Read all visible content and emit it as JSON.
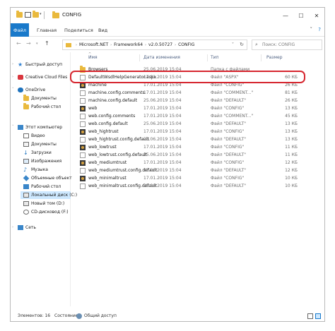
{
  "window": {
    "title": "CONFIG",
    "controls": {
      "minimize": "—",
      "maximize": "☐",
      "close": "✕"
    }
  },
  "ribbon": {
    "tabs": [
      "Файл",
      "Главная",
      "Поделиться",
      "Вид"
    ],
    "expand_icon": "˅",
    "help_icon": "?"
  },
  "address": {
    "crumbs": [
      "Microsoft.NET",
      "Framework64",
      "v2.0.50727",
      "CONFIG"
    ],
    "search_placeholder": "Поиск: CONFIG"
  },
  "sidebar": {
    "items": [
      {
        "label": "Быстрый доступ",
        "icon": "star-icon",
        "color": "#2f80d1"
      },
      {
        "label": "Creative Cloud Files",
        "icon": "creative-cloud-icon",
        "color": "#d9363e"
      },
      {
        "label": "OneDrive",
        "icon": "cloud-icon",
        "color": "#1e73be"
      },
      {
        "label": "Документы",
        "icon": "folder-icon",
        "color": "#e9b93d"
      },
      {
        "label": "Рабочий стол",
        "icon": "folder-icon",
        "color": "#e9b93d"
      },
      {
        "label": "Этот компьютер",
        "icon": "computer-icon",
        "color": "#3a86c9"
      },
      {
        "label": "Видео",
        "icon": "video-icon",
        "color": "#6b6b6b"
      },
      {
        "label": "Документы",
        "icon": "documents-icon",
        "color": "#6b6b6b"
      },
      {
        "label": "Загрузки",
        "icon": "download-icon",
        "color": "#1e73be"
      },
      {
        "label": "Изображения",
        "icon": "pictures-icon",
        "color": "#6b6b6b"
      },
      {
        "label": "Музыка",
        "icon": "music-icon",
        "color": "#1e73be"
      },
      {
        "label": "Объемные объект",
        "icon": "3d-objects-icon",
        "color": "#3a86c9"
      },
      {
        "label": "Рабочий стол",
        "icon": "desktop-icon",
        "color": "#3a86c9"
      },
      {
        "label": "Локальный диск (C:)",
        "icon": "drive-icon",
        "color": "#6b6b6b"
      },
      {
        "label": "Новый том (D:)",
        "icon": "drive-icon",
        "color": "#6b6b6b"
      },
      {
        "label": "CD-дисковод (F:)",
        "icon": "cd-drive-icon",
        "color": "#6b6b6b"
      },
      {
        "label": "Сеть",
        "icon": "network-icon",
        "color": "#3a86c9"
      }
    ]
  },
  "columns": {
    "name": "Имя",
    "date": "Дата изменения",
    "type": "Тип",
    "size": "Размер"
  },
  "files": [
    {
      "name": "Browsers",
      "date": "25.06.2019 15:04",
      "type": "Папка с файлами",
      "size": "",
      "icon": "folder-icon"
    },
    {
      "name": "DefaultWsdlHelpGenerator.aspx",
      "date": "17.01.2019 15:04",
      "type": "Файл \"ASPX\"",
      "size": "60 КБ",
      "icon": "file-icon"
    },
    {
      "name": "machine",
      "date": "17.01.2019 15:04",
      "type": "Файл \"CONFIG\"",
      "size": "26 КБ",
      "icon": "config-file-icon"
    },
    {
      "name": "machine.config.comments",
      "date": "17.01.2019 15:04",
      "type": "Файл \"COMMENT...\"",
      "size": "81 КБ",
      "icon": "file-icon"
    },
    {
      "name": "machine.config.default",
      "date": "25.06.2019 15:04",
      "type": "Файл \"DEFAULT\"",
      "size": "26 КБ",
      "icon": "file-icon"
    },
    {
      "name": "web",
      "date": "17.01.2019 15:04",
      "type": "Файл \"CONFIG\"",
      "size": "13 КБ",
      "icon": "config-file-icon"
    },
    {
      "name": "web.config.comments",
      "date": "17.01.2019 15:04",
      "type": "Файл \"COMMENT...\"",
      "size": "45 КБ",
      "icon": "file-icon"
    },
    {
      "name": "web.config.default",
      "date": "25.06.2019 15:04",
      "type": "Файл \"DEFAULT\"",
      "size": "13 КБ",
      "icon": "file-icon"
    },
    {
      "name": "web_hightrust",
      "date": "17.01.2019 15:04",
      "type": "Файл \"CONFIG\"",
      "size": "13 КБ",
      "icon": "config-file-icon"
    },
    {
      "name": "web_hightrust.config.default",
      "date": "25.06.2019 15:04",
      "type": "Файл \"DEFAULT\"",
      "size": "13 КБ",
      "icon": "file-icon"
    },
    {
      "name": "web_lowtrust",
      "date": "17.01.2019 15:04",
      "type": "Файл \"CONFIG\"",
      "size": "11 КБ",
      "icon": "config-file-icon"
    },
    {
      "name": "web_lowtrust.config.default",
      "date": "25.06.2019 15:04",
      "type": "Файл \"DEFAULT\"",
      "size": "11 КБ",
      "icon": "file-icon"
    },
    {
      "name": "web_mediumtrust",
      "date": "17.01.2019 15:04",
      "type": "Файл \"CONFIG\"",
      "size": "12 КБ",
      "icon": "config-file-icon"
    },
    {
      "name": "web_mediumtrust.config.default",
      "date": "25.06.2019 15:04",
      "type": "Файл \"DEFAULT\"",
      "size": "12 КБ",
      "icon": "file-icon"
    },
    {
      "name": "web_minimaltrust",
      "date": "17.01.2019 15:04",
      "type": "Файл \"CONFIG\"",
      "size": "10 КБ",
      "icon": "config-file-icon"
    },
    {
      "name": "web_minimaltrust.config.default",
      "date": "25.06.2019 15:04",
      "type": "Файл \"DEFAULT\"",
      "size": "10 КБ",
      "icon": "file-icon"
    }
  ],
  "status": {
    "items_label": "Элементов: 16",
    "state_label": "Состояние:",
    "state_value": "Общий доступ"
  },
  "colors": {
    "accent": "#1979ca",
    "highlight": "#d6262f",
    "folder": "#e9b93d"
  }
}
